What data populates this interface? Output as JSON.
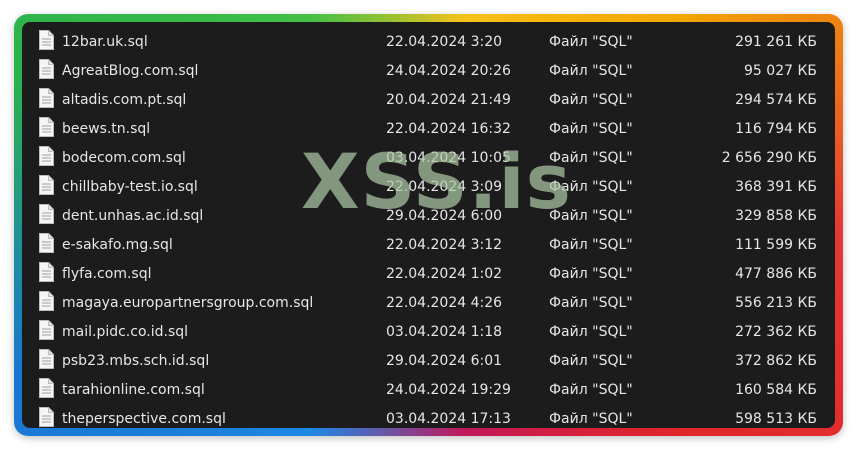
{
  "files": [
    {
      "name": "12bar.uk.sql",
      "modified": "22.04.2024 3:20",
      "type": "Файл \"SQL\"",
      "size": "291 261 КБ",
      "icon": "document-icon"
    },
    {
      "name": "AgreatBlog.com.sql",
      "modified": "24.04.2024 20:26",
      "type": "Файл \"SQL\"",
      "size": "95 027 КБ",
      "icon": "document-icon"
    },
    {
      "name": "altadis.com.pt.sql",
      "modified": "20.04.2024 21:49",
      "type": "Файл \"SQL\"",
      "size": "294 574 КБ",
      "icon": "document-icon"
    },
    {
      "name": "beews.tn.sql",
      "modified": "22.04.2024 16:32",
      "type": "Файл \"SQL\"",
      "size": "116 794 КБ",
      "icon": "document-icon"
    },
    {
      "name": "bodecom.com.sql",
      "modified": "03.04.2024 10:05",
      "type": "Файл \"SQL\"",
      "size": "2 656 290 КБ",
      "icon": "document-icon"
    },
    {
      "name": "chillbaby-test.io.sql",
      "modified": "22.04.2024 3:09",
      "type": "Файл \"SQL\"",
      "size": "368 391 КБ",
      "icon": "document-icon"
    },
    {
      "name": "dent.unhas.ac.id.sql",
      "modified": "29.04.2024 6:00",
      "type": "Файл \"SQL\"",
      "size": "329 858 КБ",
      "icon": "document-icon"
    },
    {
      "name": "e-sakafo.mg.sql",
      "modified": "22.04.2024 3:12",
      "type": "Файл \"SQL\"",
      "size": "111 599 КБ",
      "icon": "document-icon"
    },
    {
      "name": "flyfa.com.sql",
      "modified": "22.04.2024 1:02",
      "type": "Файл \"SQL\"",
      "size": "477 886 КБ",
      "icon": "document-icon"
    },
    {
      "name": "magaya.europartnersgroup.com.sql",
      "modified": "22.04.2024 4:26",
      "type": "Файл \"SQL\"",
      "size": "556 213 КБ",
      "icon": "document-icon"
    },
    {
      "name": "mail.pidc.co.id.sql",
      "modified": "03.04.2024 1:18",
      "type": "Файл \"SQL\"",
      "size": "272 362 КБ",
      "icon": "document-icon"
    },
    {
      "name": "psb23.mbs.sch.id.sql",
      "modified": "29.04.2024 6:01",
      "type": "Файл \"SQL\"",
      "size": "372 862 КБ",
      "icon": "document-icon"
    },
    {
      "name": "tarahionline.com.sql",
      "modified": "24.04.2024 19:29",
      "type": "Файл \"SQL\"",
      "size": "160 584 КБ",
      "icon": "document-icon"
    },
    {
      "name": "theperspective.com.sql",
      "modified": "03.04.2024 17:13",
      "type": "Файл \"SQL\"",
      "size": "598 513 КБ",
      "icon": "document-icon"
    }
  ],
  "watermark": "XSS.is",
  "colors": {
    "background": "#1c1c1c",
    "text": "#e6e6e6",
    "watermark": "#a8c5a0"
  }
}
